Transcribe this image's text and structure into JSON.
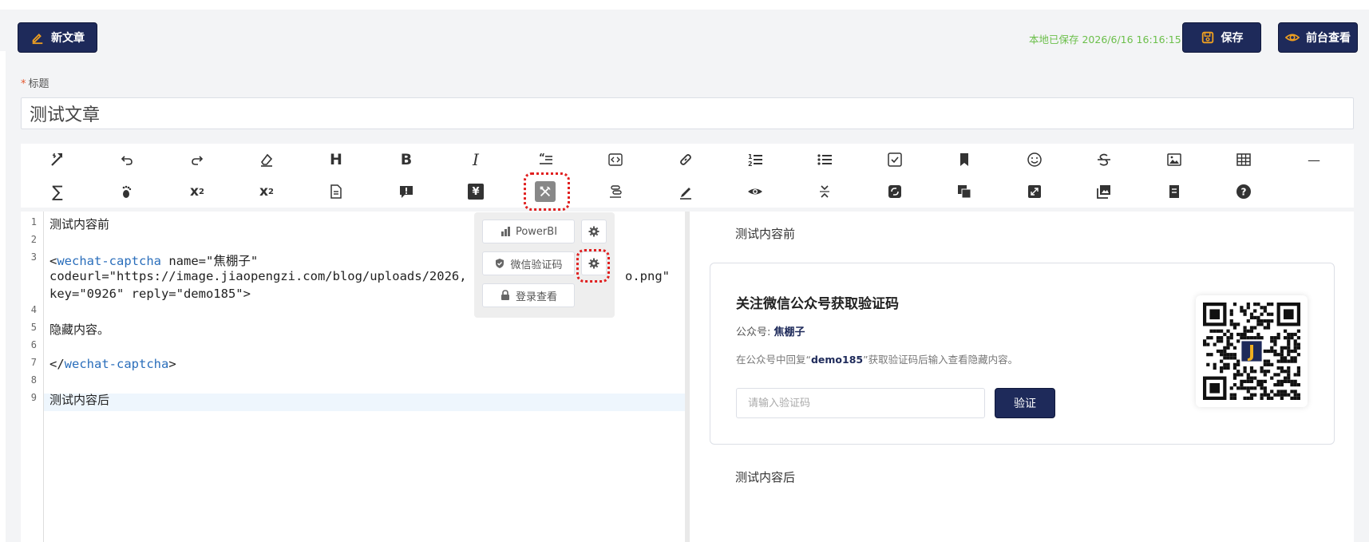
{
  "header": {
    "new_label": "新文章",
    "saved_status": "本地已保存 2026/6/16 16:16:15",
    "save_label": "保存",
    "view_label": "前台查看"
  },
  "form": {
    "title_label": "标题",
    "title_required_mark": "*",
    "title_value": "测试文章"
  },
  "toolbar": {
    "row1": [
      "magic-icon",
      "undo-icon",
      "redo-icon",
      "eraser-icon",
      "heading-icon",
      "bold-icon",
      "italic-icon",
      "quote-icon",
      "code-icon",
      "link-icon",
      "ordered-list-icon",
      "unordered-list-icon",
      "checklist-icon",
      "bookmark-icon",
      "emoji-icon",
      "strikethrough-icon",
      "image-icon",
      "table-icon",
      "horizontal-rule-icon"
    ],
    "row2": [
      "sigma-icon",
      "footnote-icon",
      "superscript-icon",
      "subscript-icon",
      "document-icon",
      "alert-icon",
      "yen-icon",
      "tools-icon",
      "toc-icon",
      "pen-icon",
      "preview-icon",
      "collapse-icon",
      "sync-icon",
      "layers-icon",
      "fullscreen-icon",
      "gallery-icon",
      "file-icon",
      "help-icon"
    ],
    "heading_glyph": "H",
    "bold_glyph": "B",
    "italic_glyph": "I",
    "sigma_glyph": "∑",
    "sup_base": "x",
    "sup_exp": "2",
    "sub_base": "x",
    "sub_exp": "2",
    "hr_glyph": "—",
    "yen_glyph": "¥",
    "active_item": "tools-icon"
  },
  "popup": {
    "items": [
      {
        "label": "PowerBI",
        "icon": "chart-icon"
      },
      {
        "label": "微信验证码",
        "icon": "shield-icon"
      },
      {
        "label": "登录查看",
        "icon": "lock-icon"
      }
    ]
  },
  "editor": {
    "line_numbers": [
      "1",
      "2",
      "3",
      "4",
      "5",
      "6",
      "7",
      "8",
      "9"
    ],
    "line1": "测试内容前",
    "line3a_open": "<",
    "line3a_tag": "wechat-captcha",
    "line3a_rest": " name=\"焦棚子\"",
    "line3b": "codeurl=\"https://image.jiaopengzi.com/blog/uploads/2026,",
    "line3b_tail": "o.png\"",
    "line3c": "key=\"0926\" reply=\"demo185\">",
    "line5": "隐藏内容。",
    "line7_open": "</",
    "line7_tag": "wechat-captcha",
    "line7_close": ">",
    "line9": "测试内容后"
  },
  "preview": {
    "before": "测试内容前",
    "after": "测试内容后",
    "card": {
      "title": "关注微信公众号获取验证码",
      "account_label": "公众号:",
      "account_name": "焦棚子",
      "desc_prefix": "在公众号中回复“",
      "desc_keyword": "demo185",
      "desc_suffix": "”获取验证码后输入查看隐藏内容。",
      "input_placeholder": "请输入验证码",
      "button_label": "验证",
      "qr_center_letter": "J"
    }
  },
  "colors": {
    "primary": "#1e2a5a",
    "saved_green": "#6bbf4a",
    "highlight_red": "#e02020"
  }
}
